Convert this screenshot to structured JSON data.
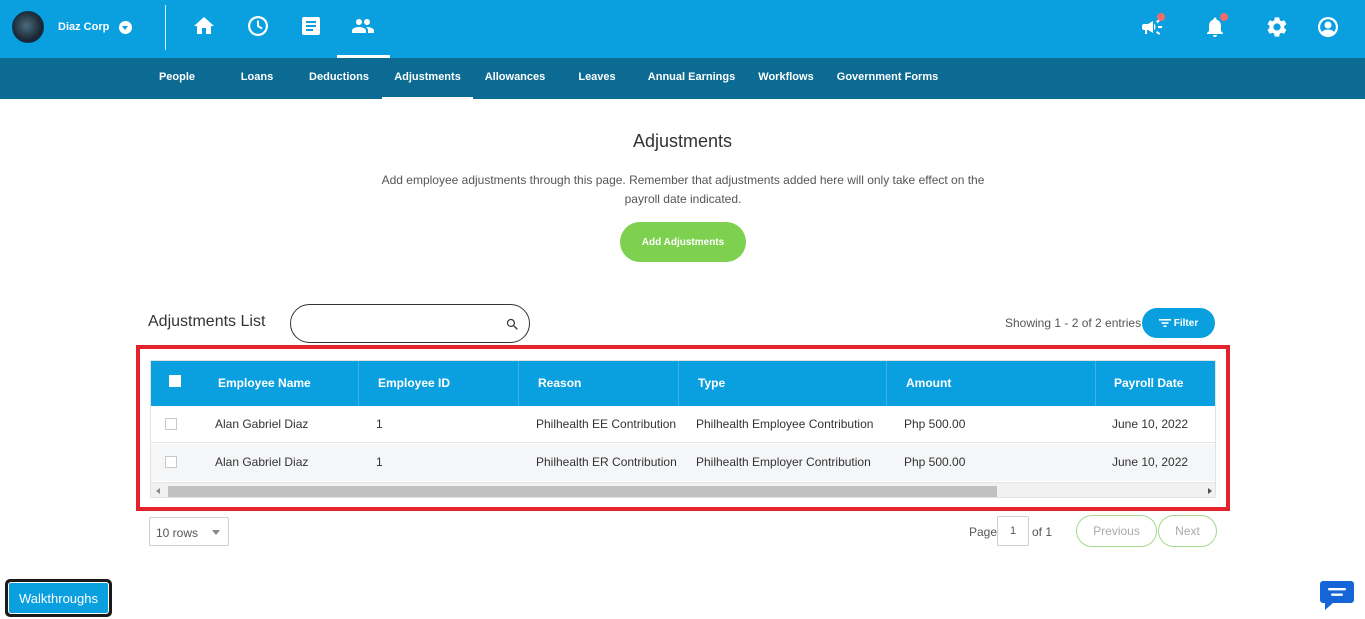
{
  "company": {
    "name": "Diaz Corp"
  },
  "topnav": {
    "icons": [
      "home-icon",
      "clock-icon",
      "document-icon",
      "people-icon"
    ],
    "right_icons": [
      "megaphone-icon",
      "bell-icon",
      "gear-icon",
      "account-icon"
    ]
  },
  "subnav": {
    "items": [
      {
        "label": "People"
      },
      {
        "label": "Loans"
      },
      {
        "label": "Deductions"
      },
      {
        "label": "Adjustments",
        "active": true
      },
      {
        "label": "Allowances"
      },
      {
        "label": "Leaves"
      },
      {
        "label": "Annual Earnings"
      },
      {
        "label": "Workflows"
      },
      {
        "label": "Government Forms"
      }
    ]
  },
  "page": {
    "title": "Adjustments",
    "description": "Add employee adjustments through this page. Remember that adjustments added here will only take effect on the payroll date indicated.",
    "add_button": "Add Adjustments"
  },
  "list": {
    "title": "Adjustments List",
    "search_value": "",
    "showing": "Showing 1 - 2 of 2 entries",
    "filter_label": "Filter"
  },
  "table": {
    "columns": [
      "Employee Name",
      "Employee ID",
      "Reason",
      "Type",
      "Amount",
      "Payroll Date"
    ],
    "rows": [
      [
        "Alan Gabriel Diaz",
        "1",
        "Philhealth EE Contribution",
        "Philhealth Employee Contribution",
        "Php 500.00",
        "June 10, 2022"
      ],
      [
        "Alan Gabriel Diaz",
        "1",
        "Philhealth ER Contribution",
        "Philhealth Employer Contribution",
        "Php 500.00",
        "June 10, 2022"
      ]
    ]
  },
  "pagination": {
    "rows_per_page": "10 rows",
    "page_label": "Page",
    "current_page": "1",
    "of_label": "of 1",
    "previous": "Previous",
    "next": "Next"
  },
  "footer": {
    "walkthroughs": "Walkthroughs"
  },
  "colors": {
    "primary": "#0aa0e0",
    "subnav": "#0b6b92",
    "accent_green": "#7dd14f",
    "highlight_red": "#e4222c",
    "notification": "#f26b6b"
  }
}
